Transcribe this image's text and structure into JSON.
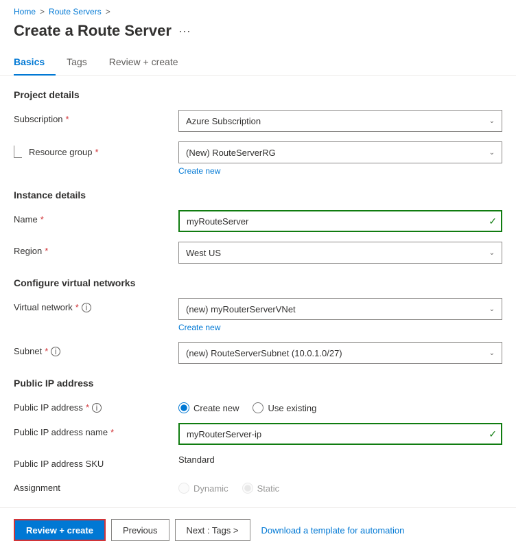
{
  "breadcrumb": {
    "home": "Home",
    "separator1": ">",
    "route_servers": "Route Servers",
    "separator2": ">"
  },
  "page": {
    "title": "Create a Route Server",
    "more_icon": "···"
  },
  "tabs": [
    {
      "id": "basics",
      "label": "Basics",
      "active": true
    },
    {
      "id": "tags",
      "label": "Tags",
      "active": false
    },
    {
      "id": "review",
      "label": "Review + create",
      "active": false
    }
  ],
  "sections": {
    "project_details": {
      "title": "Project details",
      "subscription": {
        "label": "Subscription",
        "required": true,
        "value": "Azure Subscription"
      },
      "resource_group": {
        "label": "Resource group",
        "required": true,
        "value": "(New) RouteServerRG",
        "create_new_link": "Create new"
      }
    },
    "instance_details": {
      "title": "Instance details",
      "name": {
        "label": "Name",
        "required": true,
        "value": "myRouteServer",
        "valid": true
      },
      "region": {
        "label": "Region",
        "required": true,
        "value": "West US"
      }
    },
    "virtual_networks": {
      "title": "Configure virtual networks",
      "virtual_network": {
        "label": "Virtual network",
        "required": true,
        "has_info": true,
        "value": "(new) myRouterServerVNet",
        "create_new_link": "Create new"
      },
      "subnet": {
        "label": "Subnet",
        "required": true,
        "has_info": true,
        "value": "(new) RouteServerSubnet (10.0.1.0/27)"
      }
    },
    "public_ip": {
      "title": "Public IP address",
      "public_ip_address": {
        "label": "Public IP address",
        "required": true,
        "has_info": true,
        "options": [
          {
            "id": "create_new",
            "label": "Create new",
            "selected": true
          },
          {
            "id": "use_existing",
            "label": "Use existing",
            "selected": false
          }
        ]
      },
      "public_ip_name": {
        "label": "Public IP address name",
        "required": true,
        "value": "myRouterServer-ip",
        "valid": true
      },
      "sku": {
        "label": "Public IP address SKU",
        "value": "Standard"
      },
      "assignment": {
        "label": "Assignment",
        "options": [
          {
            "id": "dynamic",
            "label": "Dynamic",
            "disabled": true
          },
          {
            "id": "static",
            "label": "Static",
            "disabled": true,
            "selected": true
          }
        ]
      }
    }
  },
  "footer": {
    "review_create": "Review + create",
    "previous": "Previous",
    "next": "Next : Tags >",
    "download_link": "Download a template for automation"
  }
}
